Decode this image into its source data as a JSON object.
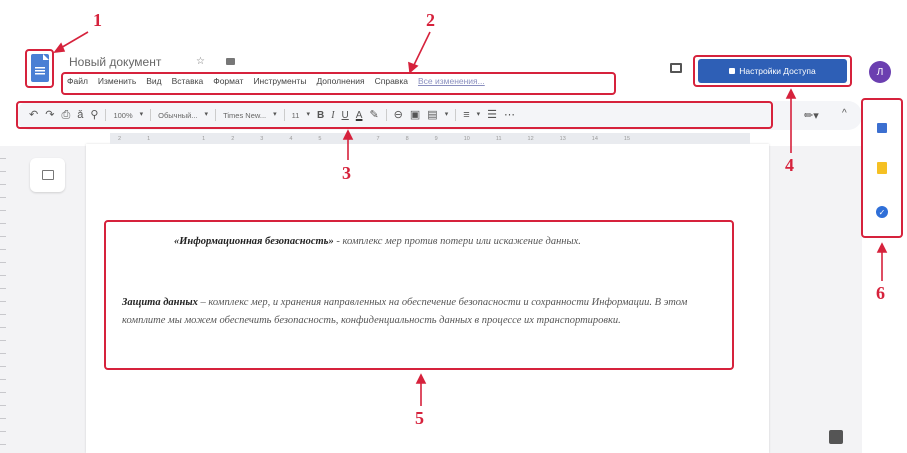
{
  "document": {
    "title": "Новый документ",
    "star_icon": "star-icon",
    "folder_icon": "folder-icon"
  },
  "menu": {
    "items": [
      "Файл",
      "Изменить",
      "Вид",
      "Вставка",
      "Формат",
      "Инструменты",
      "Дополнения",
      "Справка"
    ],
    "last_edit": "Все изменения..."
  },
  "share": {
    "label": "Настройки Доступа"
  },
  "avatar": {
    "initial": "Л",
    "color": "#6b3fb0"
  },
  "toolbar": {
    "zoom": "100%",
    "style": "Обычный...",
    "font": "Times New...",
    "size": "11",
    "bold": "B",
    "italic": "I",
    "underline": "U",
    "text_color": "A"
  },
  "ruler": {
    "ticks": [
      "2",
      "1",
      "",
      "1",
      "2",
      "3",
      "4",
      "5",
      "6",
      "7",
      "8",
      "9",
      "10",
      "11",
      "12",
      "13",
      "14",
      "15",
      "16",
      "17",
      "18"
    ]
  },
  "content": {
    "p1_bold": "«Информационная безопасность»",
    "p1_rest": " - комплекс мер против потери или искажение данных.",
    "p2_bold": "Защита данных",
    "p2_rest": " – комплекс мер, и хранения направленных на обеспечение безопасности и сохранности Информации. В этом комплите мы можем обеспечить безопасность, конфиденциальность данных в процессе их транспортировки."
  },
  "annotations": {
    "n1": "1",
    "n2": "2",
    "n3": "3",
    "n4": "4",
    "n5": "5",
    "n6": "6",
    "color": "#d6223c"
  },
  "colors": {
    "accent": "#2e5fb6",
    "annotation": "#d6223c"
  }
}
